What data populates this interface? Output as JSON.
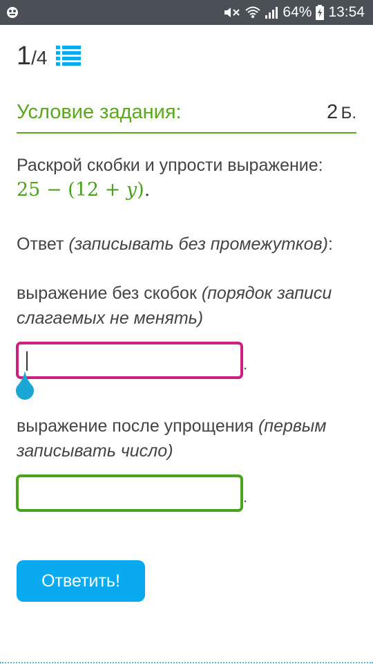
{
  "status_bar": {
    "battery_percent": "64%",
    "time": "13:54",
    "icons": [
      "notification-icon",
      "mute-icon",
      "wifi-icon",
      "signal-icon",
      "battery-charging-icon"
    ]
  },
  "counter": {
    "current": "1",
    "separator": "/",
    "total": "4",
    "list_icon": "list-icon"
  },
  "task": {
    "title": "Условие задания:",
    "points_value": "2",
    "points_unit": "Б.",
    "instruction": "Раскрой скобки и упрости выражение:",
    "formula": {
      "a": "25",
      "minus": "−",
      "open": "(",
      "b": "12",
      "plus": "+",
      "var": "y",
      "close": ")",
      "period": "."
    }
  },
  "answer": {
    "label": "Ответ",
    "note": "(записывать без промежутков)",
    "colon": ":",
    "field1": {
      "label": "выражение без скобок",
      "note": "(порядок записи слагаемых не менять)",
      "value": "",
      "suffix": "."
    },
    "field2": {
      "label": "выражение после упрощения",
      "note": "(первым записывать число)",
      "value": "",
      "suffix": "."
    }
  },
  "submit": {
    "label": "Ответить!"
  },
  "colors": {
    "status_bar": "#4a5055",
    "accent_green": "#5aa81c",
    "active_field": "#cc1f7f",
    "button": "#0aaaf0",
    "cursor_handle": "#1ba7d6"
  }
}
